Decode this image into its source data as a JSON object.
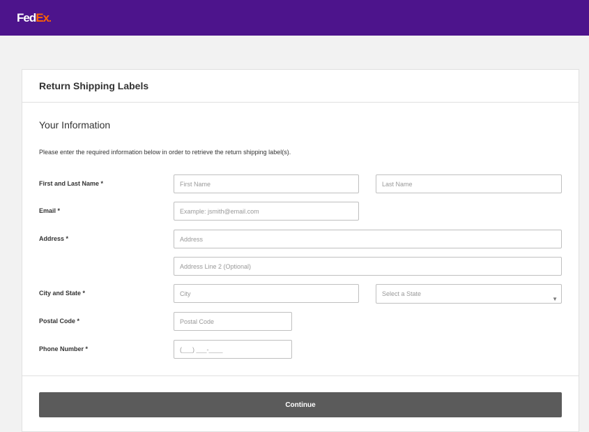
{
  "header": {
    "logo_fed": "Fed",
    "logo_ex": "Ex",
    "logo_dot": "."
  },
  "card": {
    "title": "Return Shipping Labels"
  },
  "form": {
    "section_title": "Your Information",
    "instructions": "Please enter the required information below in order to retrieve the return shipping label(s).",
    "name_label": "First and Last Name *",
    "first_name_placeholder": "First Name",
    "last_name_placeholder": "Last Name",
    "email_label": "Email *",
    "email_placeholder": "Example: jsmith@email.com",
    "address_label": "Address *",
    "address_placeholder": "Address",
    "address2_placeholder": "Address Line 2 (Optional)",
    "city_state_label": "City and State *",
    "city_placeholder": "City",
    "state_select_value": "Select a State",
    "postal_label": "Postal Code *",
    "postal_placeholder": "Postal Code",
    "phone_label": "Phone Number *",
    "phone_placeholder": "(___) ___-____",
    "continue_label": "Continue"
  },
  "colors": {
    "brand_purple": "#4d148c",
    "brand_orange": "#ff6200",
    "button_gray": "#5b5b5b"
  }
}
